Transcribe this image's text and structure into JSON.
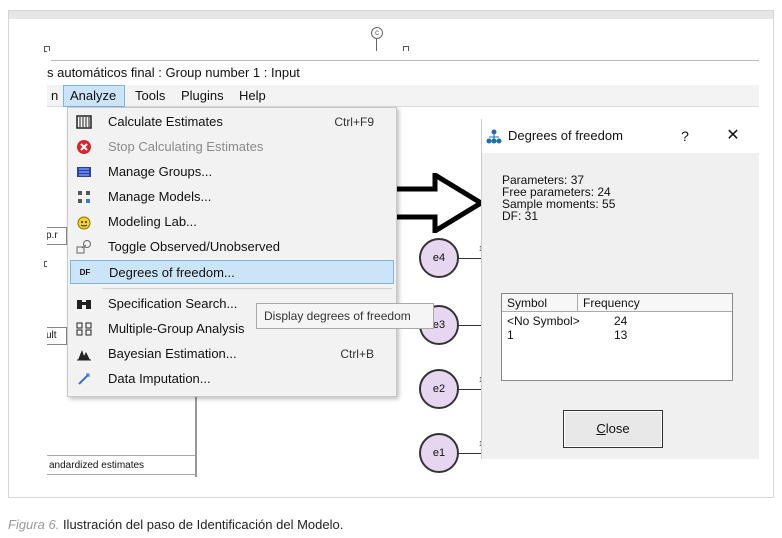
{
  "window": {
    "title": "s automáticos final : Group number 1 : Input"
  },
  "menubar": {
    "items": [
      {
        "label": "n"
      },
      {
        "label": "Analyze"
      },
      {
        "label": "Tools"
      },
      {
        "label": "Plugins"
      },
      {
        "label": "Help"
      }
    ]
  },
  "analyze_menu": {
    "items": [
      {
        "label": "Calculate Estimates",
        "shortcut": "Ctrl+F9",
        "icon": "abacus-icon"
      },
      {
        "label": "Stop Calculating Estimates",
        "shortcut": "",
        "icon": "stop-icon",
        "disabled": true
      },
      {
        "label": "Manage Groups...",
        "shortcut": "",
        "icon": "groups-icon"
      },
      {
        "label": "Manage Models...",
        "shortcut": "",
        "icon": "models-icon"
      },
      {
        "label": "Modeling Lab...",
        "shortcut": "",
        "icon": "lab-icon"
      },
      {
        "label": "Toggle Observed/Unobserved",
        "shortcut": "",
        "icon": "toggle-icon"
      },
      {
        "label": "Degrees of freedom...",
        "shortcut": "",
        "icon": "df-icon",
        "icon_text": "DF"
      },
      {
        "label": "Specification Search...",
        "shortcut": "",
        "icon": "binoculars-icon"
      },
      {
        "label": "Multiple-Group Analysis",
        "shortcut": "",
        "icon": "multigroup-icon"
      },
      {
        "label": "Bayesian Estimation...",
        "shortcut": "Ctrl+B",
        "icon": "bayes-icon"
      },
      {
        "label": "Data Imputation...",
        "shortcut": "",
        "icon": "imputation-icon"
      }
    ]
  },
  "tooltip": {
    "text": "Display degrees of freedom"
  },
  "left_panel": {
    "tab1": "p.r",
    "tab2": "ult",
    "status": "andardized estimates"
  },
  "dof_dialog": {
    "title": "Degrees of freedom",
    "help": "?",
    "close_x": "✕",
    "stats": {
      "parameters": "Parameters: 37",
      "free": "Free parameters: 24",
      "moments": "Sample moments: 55",
      "df": "DF: 31"
    },
    "table": {
      "headers": [
        "Symbol",
        "Frequency"
      ],
      "rows": [
        {
          "symbol": "<No Symbol>",
          "frequency": "24"
        },
        {
          "symbol": "1",
          "frequency": "13"
        }
      ]
    },
    "close_button": {
      "underlined": "C",
      "rest": "lose"
    }
  },
  "diagram": {
    "nodes": [
      {
        "label": "e4"
      },
      {
        "label": "e3"
      },
      {
        "label": "e2"
      },
      {
        "label": "e1"
      }
    ],
    "path_label": "1"
  },
  "caption": {
    "label": "Figura 6.",
    "text": "Ilustración del paso de Identificación del Modelo."
  },
  "colors": {
    "highlight": "#cce4f7",
    "node_fill": "#e7d6ef"
  }
}
